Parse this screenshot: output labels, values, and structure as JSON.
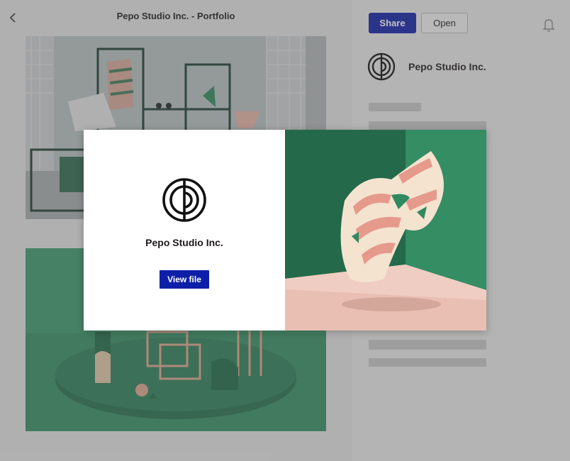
{
  "header": {
    "back_icon": "chevron-left-icon",
    "title": "Pepo Studio Inc. - Portfolio"
  },
  "toolbar": {
    "share_label": "Share",
    "open_label": "Open",
    "notifications_icon": "bell-icon"
  },
  "sidebar": {
    "owner_name": "Pepo Studio Inc.",
    "owner_logo_icon": "pepo-logo-icon"
  },
  "modal": {
    "logo_icon": "pepo-logo-icon",
    "title": "Pepo Studio Inc.",
    "button_label": "View file",
    "image_subject": "floating striped fabric in green room"
  },
  "colors": {
    "primary": "#0d1fa8",
    "overlay": "#5a5a5a",
    "text": "#1e1919",
    "accent_green": "#2f8a60",
    "accent_pink": "#e8a594"
  }
}
